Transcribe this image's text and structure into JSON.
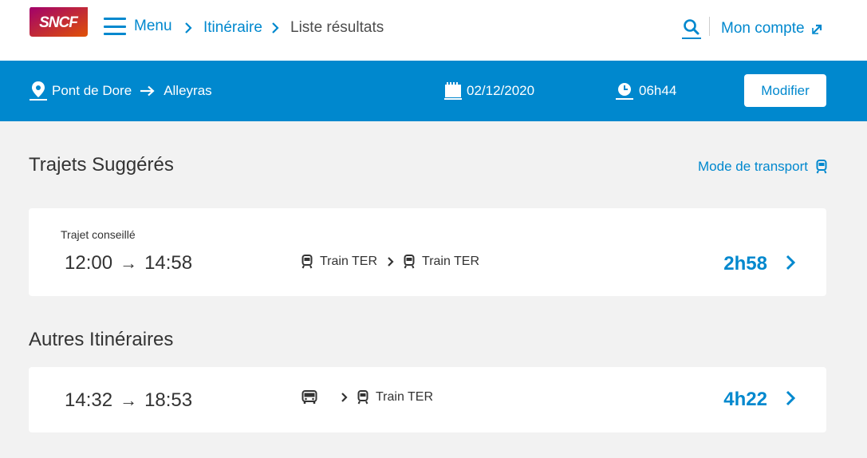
{
  "header": {
    "logo_text": "SNCF",
    "menu_label": "Menu",
    "breadcrumb": [
      "Itinéraire",
      "Liste résultats"
    ],
    "account_label": "Mon compte"
  },
  "search": {
    "origin": "Pont de Dore",
    "destination": "Alleyras",
    "date": "02/12/2020",
    "time": "06h44",
    "modify_label": "Modifier"
  },
  "suggested": {
    "title": "Trajets Suggérés",
    "transport_mode_label": "Mode de transport",
    "journey": {
      "tag": "Trajet conseillé",
      "departure": "12:00",
      "arrival": "14:58",
      "legs": [
        {
          "mode": "train",
          "label": "Train TER"
        },
        {
          "mode": "train",
          "label": "Train TER"
        }
      ],
      "duration": "2h58"
    }
  },
  "others": {
    "title": "Autres Itinéraires",
    "journeys": [
      {
        "departure": "14:32",
        "arrival": "18:53",
        "legs": [
          {
            "mode": "bus",
            "label": ""
          },
          {
            "mode": "train",
            "label": "Train TER"
          }
        ],
        "duration": "4h22"
      }
    ]
  },
  "colors": {
    "accent": "#0088ce",
    "logo_gradient": [
      "#a1006b",
      "#e05206"
    ],
    "page_background": "#f2f2f2"
  },
  "icons": [
    "sncf-logo",
    "menu-icon",
    "chevron-right-icon",
    "search-icon",
    "external-link-icon",
    "location-pin-icon",
    "arrow-right-icon",
    "calendar-icon",
    "clock-icon",
    "train-icon",
    "bus-icon"
  ]
}
